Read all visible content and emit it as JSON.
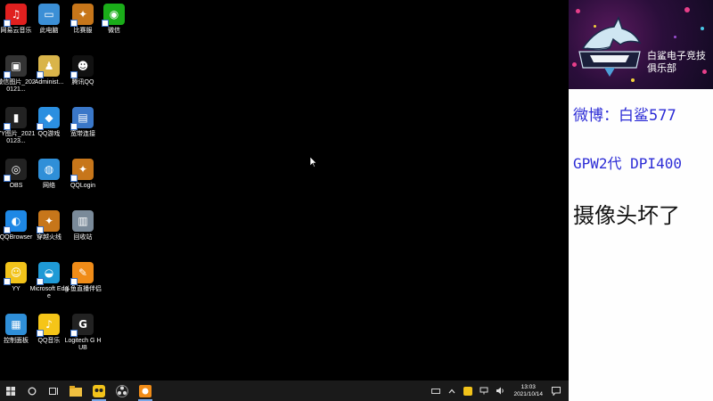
{
  "desktop": {
    "icons": [
      {
        "label": "网易云音乐",
        "icon": "netease-music-icon",
        "color": "#e0201f",
        "glyph": "♫"
      },
      {
        "label": "此电脑",
        "icon": "this-pc-icon",
        "color": "#3b8fd6",
        "glyph": "▭"
      },
      {
        "label": "比赛服",
        "icon": "match-server-icon",
        "color": "#c7761a",
        "glyph": "✦"
      },
      {
        "label": "微信",
        "icon": "wechat-icon",
        "color": "#1aad19",
        "glyph": "◉"
      },
      {
        "label": "微信图片_2020121...",
        "icon": "image-file-icon",
        "color": "#333",
        "glyph": "▣"
      },
      {
        "label": "Administ...",
        "icon": "user-folder-icon",
        "color": "#d9b44a",
        "glyph": "♟"
      },
      {
        "label": "腾讯QQ",
        "icon": "qq-icon",
        "color": "#111",
        "glyph": "☻"
      },
      {
        "label": "YY图片_20210123...",
        "icon": "image-file-icon",
        "color": "#222",
        "glyph": "▮"
      },
      {
        "label": "QQ游戏",
        "icon": "qq-game-icon",
        "color": "#2b8fe0",
        "glyph": "◆"
      },
      {
        "label": "宽带连接",
        "icon": "broadband-icon",
        "color": "#3a77c8",
        "glyph": "▤"
      },
      {
        "label": "OBS",
        "icon": "obs-icon",
        "color": "#222",
        "glyph": "◎"
      },
      {
        "label": "网络",
        "icon": "network-icon",
        "color": "#2f8fd8",
        "glyph": "◍"
      },
      {
        "label": "QQLogin",
        "icon": "qqlogin-icon",
        "color": "#c7761a",
        "glyph": "✦"
      },
      {
        "label": "QQBrowser",
        "icon": "qqbrowser-icon",
        "color": "#1e88e5",
        "glyph": "◐"
      },
      {
        "label": "穿越火线",
        "icon": "crossfire-icon",
        "color": "#c7761a",
        "glyph": "✦"
      },
      {
        "label": "回收站",
        "icon": "recycle-bin-icon",
        "color": "#7a8a99",
        "glyph": "▥"
      },
      {
        "label": "YY",
        "icon": "yy-icon",
        "color": "#f2c31a",
        "glyph": "☺"
      },
      {
        "label": "Microsoft Edge",
        "icon": "edge-icon",
        "color": "#1f9ad6",
        "glyph": "◒"
      },
      {
        "label": "斗鱼直播伴侣",
        "icon": "douyu-icon",
        "color": "#f08c18",
        "glyph": "✎"
      },
      {
        "label": "控制面板",
        "icon": "control-panel-icon",
        "color": "#2f8fd8",
        "glyph": "▦"
      },
      {
        "label": "QQ音乐",
        "icon": "qq-music-icon",
        "color": "#f5c518",
        "glyph": "♪"
      },
      {
        "label": "Logitech G HUB",
        "icon": "logitech-ghub-icon",
        "color": "#222",
        "glyph": "G"
      }
    ]
  },
  "taskbar": {
    "clock_time": "13:03",
    "clock_date": "2021/10/14"
  },
  "side_panel": {
    "club_name_line1": "白鲨电子竞技",
    "club_name_line2": "俱乐部",
    "weibo": "微博：白鲨577",
    "mouse": "GPW2代 DPI400",
    "camera": "摄像头坏了"
  }
}
